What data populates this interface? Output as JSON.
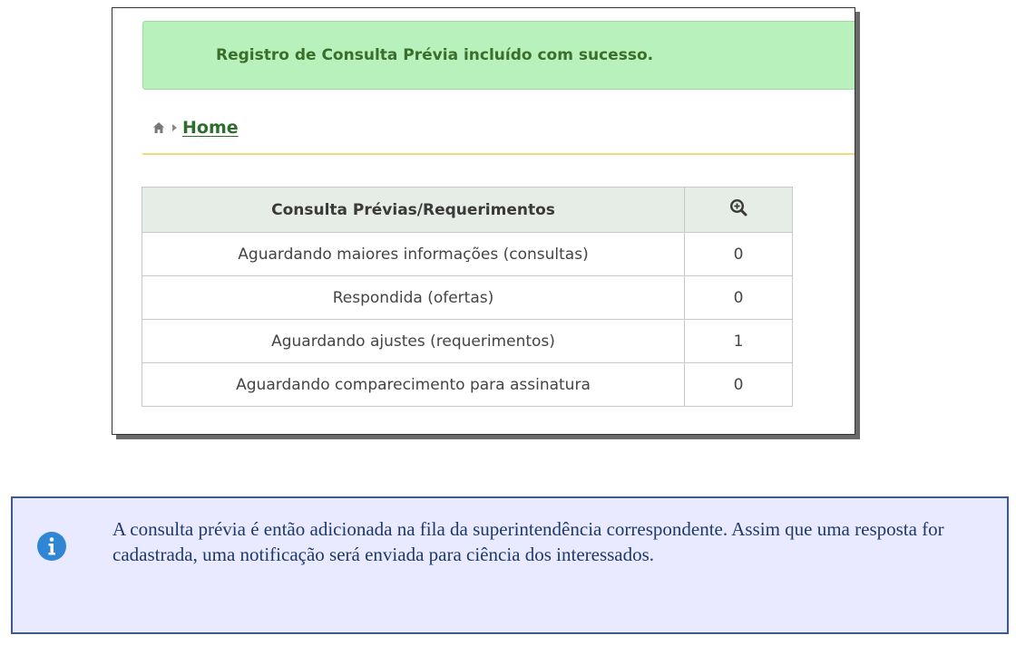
{
  "alert": {
    "message": "Registro de Consulta Prévia incluído com sucesso.",
    "color": "#b9f1bc"
  },
  "breadcrumb": {
    "home_icon": "home-icon",
    "home_label": "Home"
  },
  "table": {
    "header_label": "Consulta Prévias/Requerimentos",
    "header_icon": "zoom-in-icon",
    "rows": [
      {
        "label": "Aguardando maiores informações (consultas)",
        "count": "0"
      },
      {
        "label": "Respondida (ofertas)",
        "count": "0"
      },
      {
        "label": "Aguardando ajustes (requerimentos)",
        "count": "1"
      },
      {
        "label": "Aguardando comparecimento para assinatura",
        "count": "0"
      }
    ]
  },
  "note": {
    "icon": "info-icon",
    "text": "A consulta prévia é então adicionada na fila da superintendência correspondente. Assim que uma resposta for cadastrada, uma notificação será enviada para ciência dos interessados."
  }
}
